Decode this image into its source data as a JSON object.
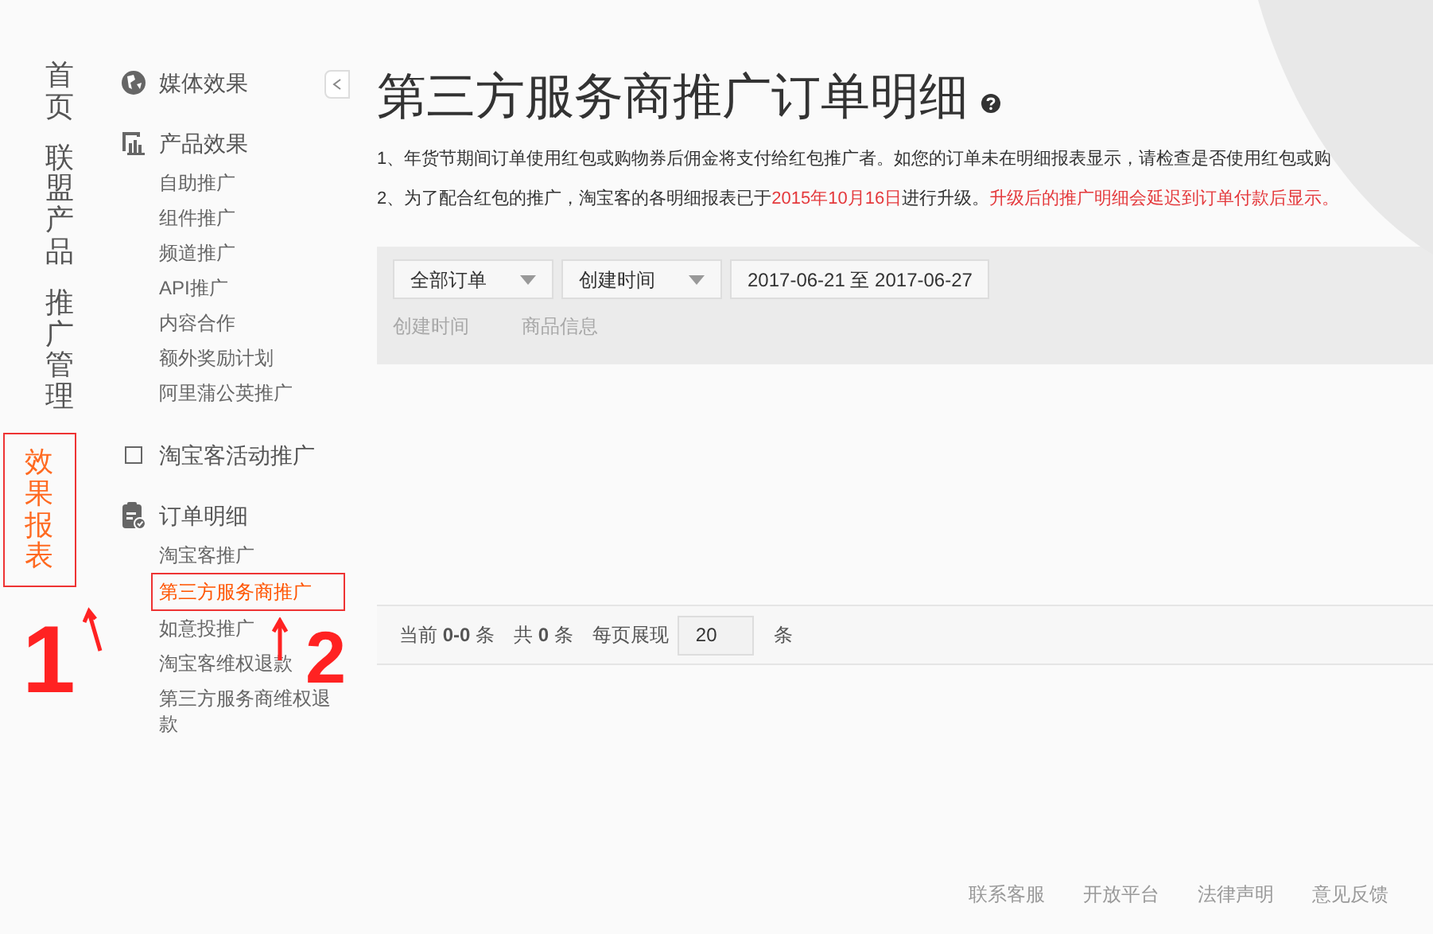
{
  "main_nav": [
    {
      "label": "首页",
      "selected": false,
      "highlighted": false
    },
    {
      "label": "联盟产品",
      "selected": false,
      "highlighted": false
    },
    {
      "label": "推广管理",
      "selected": false,
      "highlighted": false
    },
    {
      "label": "效果报表",
      "selected": true,
      "highlighted": true
    }
  ],
  "sub_nav": [
    {
      "title": "媒体效果",
      "kind": "globe"
    },
    {
      "title": "产品效果",
      "kind": "chart",
      "items": [
        {
          "label": "自助推广",
          "selected": false,
          "highlighted": false
        },
        {
          "label": "组件推广",
          "selected": false,
          "highlighted": false
        },
        {
          "label": "频道推广",
          "selected": false,
          "highlighted": false
        },
        {
          "label": "API推广",
          "selected": false,
          "highlighted": false
        },
        {
          "label": "内容合作",
          "selected": false,
          "highlighted": false
        },
        {
          "label": "额外奖励计划",
          "selected": false,
          "highlighted": false
        },
        {
          "label": "阿里蒲公英推广",
          "selected": false,
          "highlighted": false
        }
      ]
    },
    {
      "title": "淘宝客活动推广",
      "kind": "square"
    },
    {
      "title": "订单明细",
      "kind": "clipboard",
      "items": [
        {
          "label": "淘宝客推广",
          "selected": false,
          "highlighted": false
        },
        {
          "label": "第三方服务商推广",
          "selected": true,
          "highlighted": true
        },
        {
          "label": "如意投推广",
          "selected": false,
          "highlighted": false
        },
        {
          "label": "淘宝客维权退款",
          "selected": false,
          "highlighted": false
        },
        {
          "label": "第三方服务商维权退款",
          "selected": false,
          "highlighted": false
        }
      ]
    }
  ],
  "annotations": [
    "1",
    "2"
  ],
  "page_title": "第三方服务商推广订单明细",
  "notices": [
    [
      {
        "text": "1、年货节期间订单使用红包或购物券后佣金将支付给红包推广者。如您的订单未在明细报表显示，请检查是否使用红包或购",
        "kind": "normal"
      }
    ],
    [
      {
        "text": "2、为了配合红包的推广，淘宝客的各明细报表已于",
        "kind": "normal"
      },
      {
        "text": "2015年10月16日",
        "kind": "alert"
      },
      {
        "text": "进行升级。",
        "kind": "normal"
      },
      {
        "text": "升级后的推广明细会延迟到订单付款后显示。",
        "kind": "alert"
      }
    ]
  ],
  "filters": {
    "order_type": "全部订单",
    "time_type": "创建时间",
    "date_range": "2017-06-21 至 2017-06-27"
  },
  "table": {
    "columns": [
      "创建时间",
      "商品信息"
    ]
  },
  "pagination": {
    "text": "当前 **0-0** 条　共 **0** 条",
    "per_page_label": "每页展现",
    "per_page": "20",
    "unit": "条"
  },
  "footer_links": [
    "联系客服",
    "开放平台",
    "法律声明",
    "意见反馈"
  ]
}
